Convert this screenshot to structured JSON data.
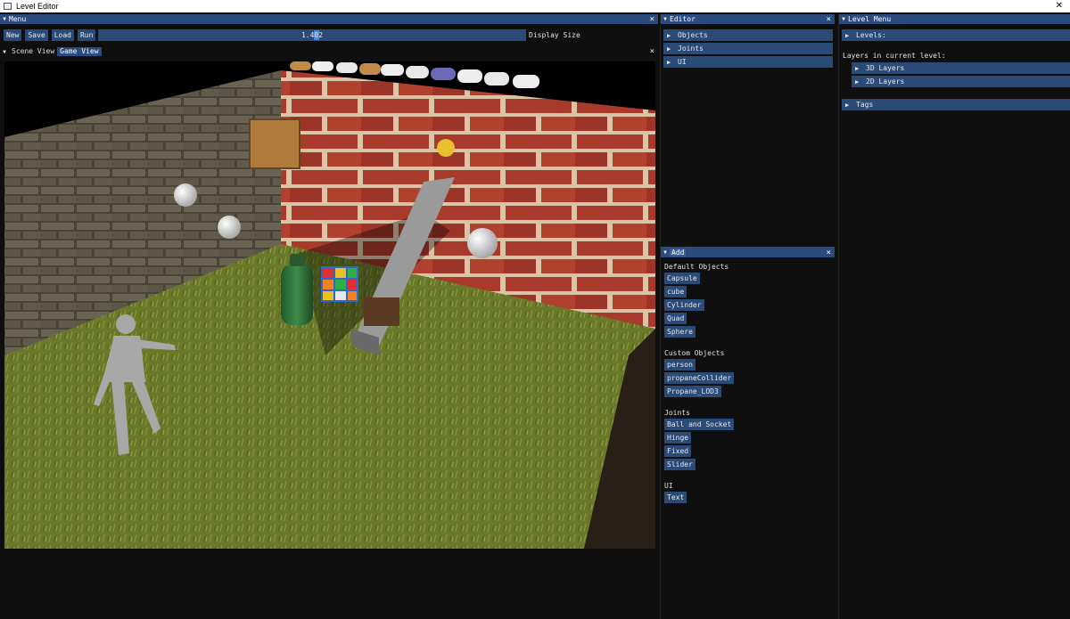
{
  "app": {
    "title": "Level Editor"
  },
  "menu_window": {
    "title": "Menu",
    "buttons": {
      "new": "New",
      "save": "Save",
      "load": "Load",
      "run": "Run"
    },
    "display_size": {
      "value": "1.402",
      "label": "Display Size",
      "fraction": 0.51
    }
  },
  "view_tabs": {
    "scene": "Scene View",
    "game": "Game View"
  },
  "editor_window": {
    "title": "Editor",
    "items": [
      "Objects",
      "Joints",
      "UI"
    ]
  },
  "level_menu": {
    "title": "Level Menu",
    "levels": "Levels:",
    "layers_label": "Layers in current level:",
    "layers": [
      "3D Layers",
      "2D Layers"
    ],
    "tags": "Tags"
  },
  "add_window": {
    "title": "Add",
    "default_objects_label": "Default Objects",
    "default_objects": [
      "Capsule",
      "cube",
      "Cylinder",
      "Quad",
      "Sphere"
    ],
    "custom_objects_label": "Custom Objects",
    "custom_objects": [
      "person",
      "propaneCollider",
      "Propane_LOD3"
    ],
    "joints_label": "Joints",
    "joints": [
      "Ball and Socket",
      "Hinge",
      "Fixed",
      "Slider"
    ],
    "ui_label": "UI",
    "ui": [
      "Text"
    ]
  },
  "colors": {
    "title_bar": "#2b4a7e",
    "button": "#2a4b78",
    "slider_grab": "#4a86d6",
    "background": "#0f0f0f"
  }
}
